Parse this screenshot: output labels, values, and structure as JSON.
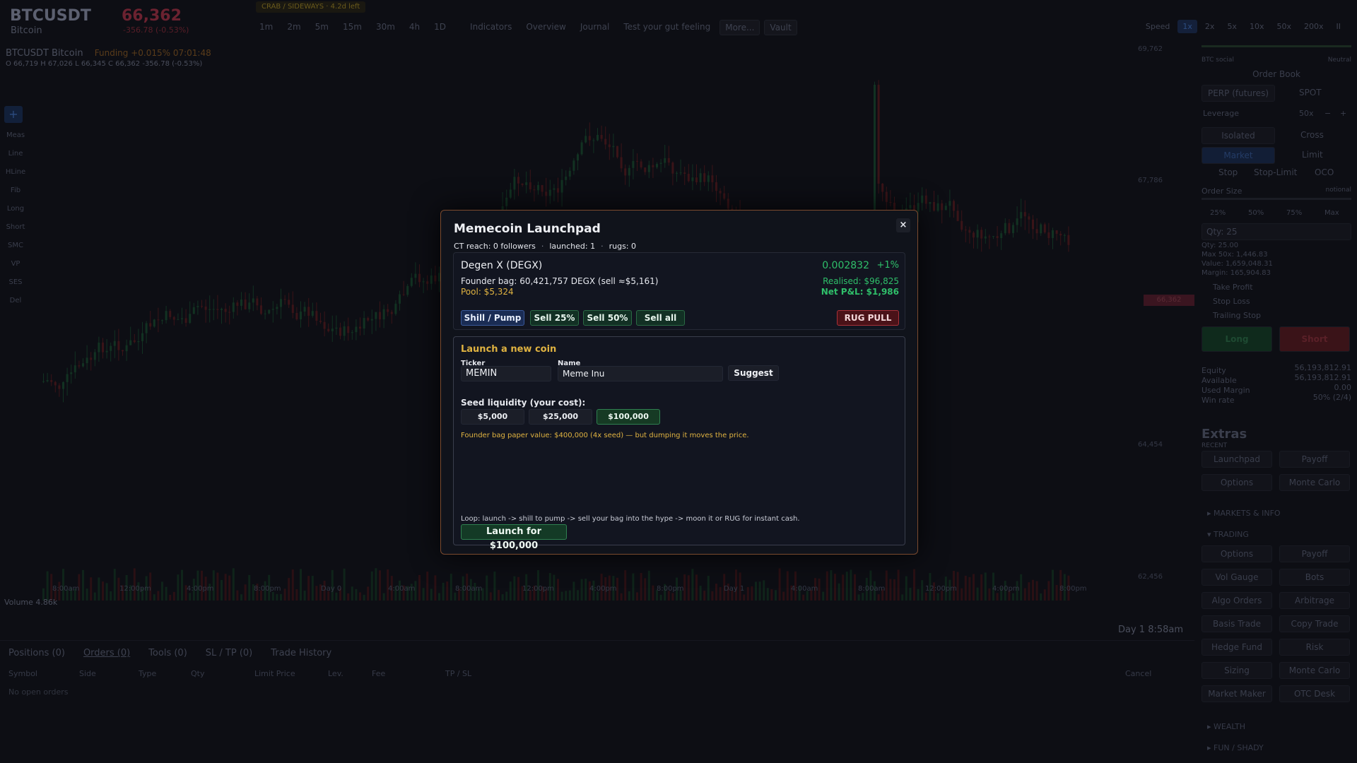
{
  "header": {
    "symbol": "BTCUSDT",
    "symbol_name": "Bitcoin",
    "price": "66,362",
    "price_change": "-356.78 (-0.53%)",
    "regime": "CRAB / SIDEWAYS · 4.2d left",
    "timeframes": [
      "1m",
      "2m",
      "5m",
      "15m",
      "30m",
      "4h",
      "1D"
    ],
    "menu": [
      "Indicators",
      "Overview",
      "Journal",
      "Test your gut feeling",
      "More...",
      "Vault"
    ],
    "speed_label": "Speed",
    "speeds": [
      "1x",
      "2x",
      "5x",
      "10x",
      "50x",
      "200x",
      "II"
    ],
    "speed_active": "1x"
  },
  "chart": {
    "info_line": "BTCUSDT  Bitcoin",
    "funding": "Funding +0.015%  07:01:48",
    "ohlc": "O 66,719  H 67,026  L 66,345  C 66,362   -356.78 (-0.53%)",
    "tools": [
      "Meas",
      "Line",
      "HLine",
      "Fib",
      "Long",
      "Short",
      "SMC",
      "VP",
      "SES",
      "Del"
    ],
    "y_ticks": [
      "69,762",
      "67,786",
      "64,454",
      "62,456"
    ],
    "x_ticks": [
      "8:00am",
      "12:00pm",
      "4:00pm",
      "8:00pm",
      "Day 0",
      "4:00am",
      "8:00am",
      "12:00pm",
      "4:00pm",
      "8:00pm",
      "Day 1",
      "4:00am",
      "8:00am",
      "12:00pm",
      "4:00pm",
      "8:00pm"
    ],
    "price_tag": "66,362",
    "volume": "Volume  4.86k",
    "day_time": "Day 1  8:58am"
  },
  "bottom": {
    "tabs": [
      "Positions (0)",
      "Orders (0)",
      "Tools (0)",
      "SL / TP (0)",
      "Trade History"
    ],
    "columns": [
      "Symbol",
      "Side",
      "Type",
      "Qty",
      "Limit Price",
      "Lev.",
      "Fee",
      "TP / SL",
      "Cancel"
    ],
    "empty": "No open orders"
  },
  "right": {
    "sentiment_label": "BTC social",
    "sentiment_value": "Neutral",
    "order_book": "Order Book",
    "perp": "PERP (futures)",
    "spot": "SPOT",
    "leverage_label": "Leverage",
    "leverage_value": "50x",
    "isolated": "Isolated",
    "cross": "Cross",
    "market": "Market",
    "limit": "Limit",
    "stop": "Stop",
    "stop_limit": "Stop-Limit",
    "oco": "OCO",
    "order_size": "Order Size",
    "notional": "notional",
    "pcts": [
      "25%",
      "50%",
      "75%",
      "Max"
    ],
    "qty": "Qty: 25",
    "qty_line": "Qty: 25.00",
    "max_line": "Max 50x: 1,446.83",
    "value_line": "Value: 1,659,048.31",
    "margin_line": "Margin: 165,904.83",
    "tp": "Take Profit",
    "sl": "Stop Loss",
    "ts": "Trailing Stop",
    "long": "Long",
    "short": "Short",
    "equity_label": "Equity",
    "equity": "56,193,812.91",
    "available_label": "Available",
    "available": "56,193,812.91",
    "used_label": "Used Margin",
    "used": "0.00",
    "win_label": "Win rate",
    "win": "50% (2/4)",
    "extras": "Extras",
    "recent": "RECENT",
    "recent_items": [
      "Launchpad",
      "Payoff",
      "Options",
      "Monte Carlo"
    ],
    "markets_section": "MARKETS & INFO",
    "trading_section": "TRADING",
    "trading_items": [
      "Options",
      "Payoff",
      "Vol Gauge",
      "Bots",
      "Algo Orders",
      "Arbitrage",
      "Basis Trade",
      "Copy Trade",
      "Hedge Fund",
      "Risk",
      "Sizing",
      "Monte Carlo",
      "Market Maker",
      "OTC Desk"
    ],
    "wealth_section": "WEALTH",
    "fun_section": "FUN / SHADY"
  },
  "modal": {
    "title": "Memecoin Launchpad",
    "close": "×",
    "stats": {
      "reach": "CT reach: 0 followers",
      "launched": "launched: 1",
      "rugs": "rugs: 0"
    },
    "coin": {
      "name": "Degen X  (DEGX)",
      "price": "0.002832",
      "change": "+1%",
      "founder_bag": "Founder bag:  60,421,757 DEGX   (sell ≈$5,161)",
      "pool": "Pool:  $5,324",
      "realised": "Realised:  $96,825",
      "net_pnl": "Net P&L:  $1,986",
      "btn_shill": "Shill / Pump",
      "btn_sell25": "Sell 25%",
      "btn_sell50": "Sell 50%",
      "btn_sellall": "Sell all",
      "btn_rug": "RUG PULL"
    },
    "launch": {
      "title": "Launch a new coin",
      "ticker_label": "Ticker",
      "ticker_value": "MEMIN",
      "name_label": "Name",
      "name_value": "Meme Inu",
      "suggest": "Suggest",
      "seed_label": "Seed liquidity (your cost):",
      "seeds": [
        "$5,000",
        "$25,000",
        "$100,000"
      ],
      "seed_selected": "$100,000",
      "paper_value": "Founder bag paper value:  $400,000  (4x seed) — but dumping it moves the price.",
      "loop": "Loop: launch -> shill to pump -> sell your bag into the hype -> moon it or RUG for instant cash.",
      "launch_btn": "Launch for $100,000"
    }
  }
}
